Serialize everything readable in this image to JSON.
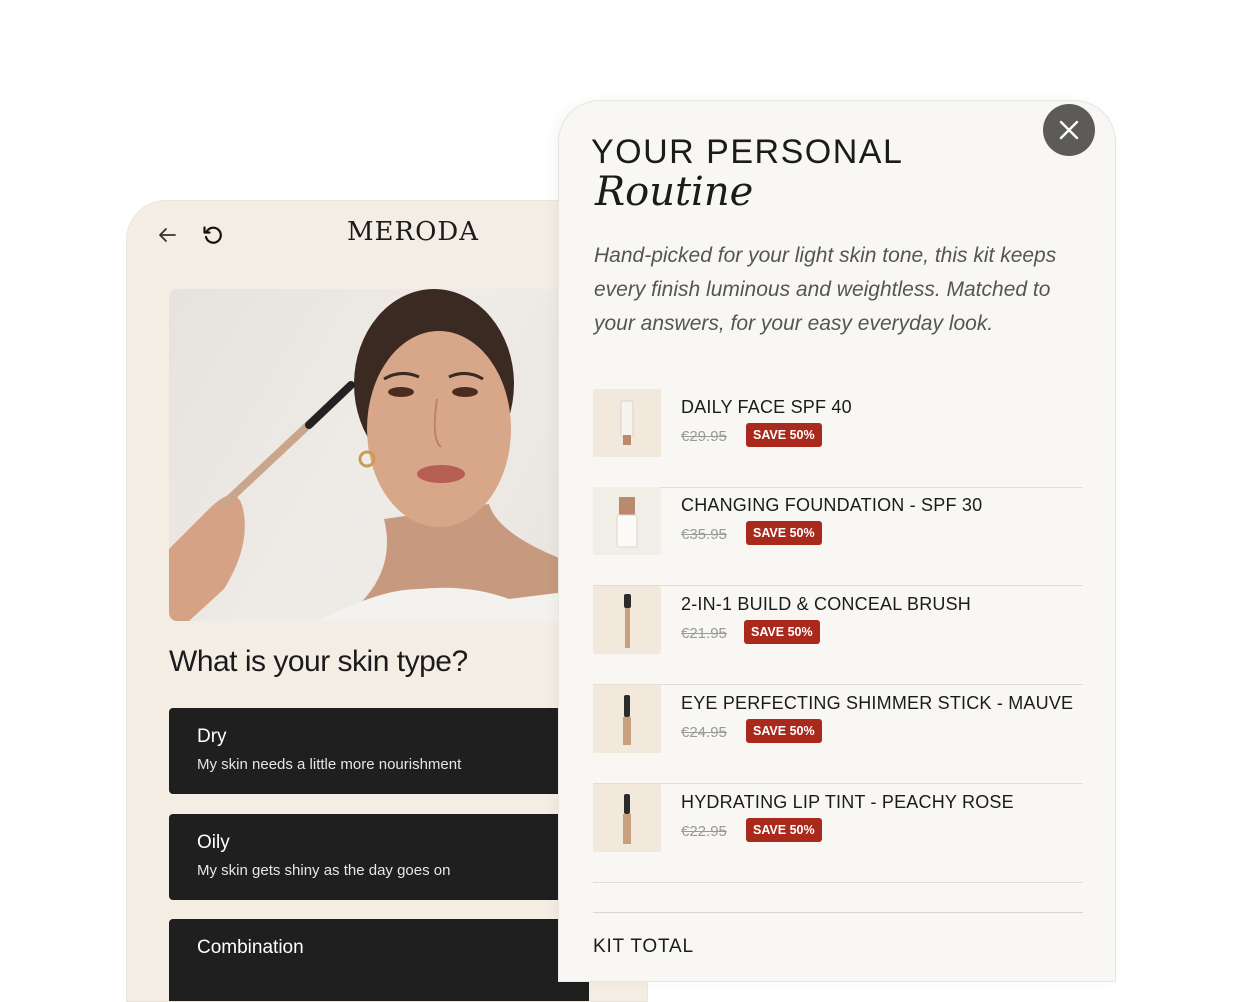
{
  "quiz": {
    "brand": "MERODA",
    "question": "What is your skin type?",
    "options": [
      {
        "title": "Dry",
        "desc": "My skin needs a little more nourishment"
      },
      {
        "title": "Oily",
        "desc": "My skin gets shiny as the day goes on"
      },
      {
        "title": "Combination",
        "desc": ""
      }
    ]
  },
  "routine": {
    "title_line1": "YOUR PERSONAL",
    "title_line2": "Routine",
    "description": "Hand-picked for your light skin tone, this kit keeps every finish luminous and weightless. Matched to your answers, for your easy everyday look.",
    "products": [
      {
        "name": "DAILY FACE SPF 40",
        "old_price": "€29.95",
        "badge": "SAVE 50%"
      },
      {
        "name": "CHANGING FOUNDATION - SPF 30",
        "old_price": "€35.95",
        "badge": "SAVE 50%"
      },
      {
        "name": "2-IN-1 BUILD & CONCEAL BRUSH",
        "old_price": "€21.95",
        "badge": "SAVE 50%"
      },
      {
        "name": "EYE PERFECTING SHIMMER STICK - MAUVE",
        "old_price": "€24.95",
        "badge": "SAVE 50%"
      },
      {
        "name": "HYDRATING LIP TINT - PEACHY ROSE",
        "old_price": "€22.95",
        "badge": "SAVE 50%"
      }
    ],
    "kit_total_label": "KIT TOTAL"
  },
  "colors": {
    "quiz_bg": "#f4ede4",
    "option_bg": "#1f1f1f",
    "panel_bg": "#f8f7f4",
    "badge_red": "#a9291c",
    "close_button": "#5d5b58"
  },
  "icons": [
    "back-arrow-icon",
    "reset-icon",
    "close-icon"
  ]
}
